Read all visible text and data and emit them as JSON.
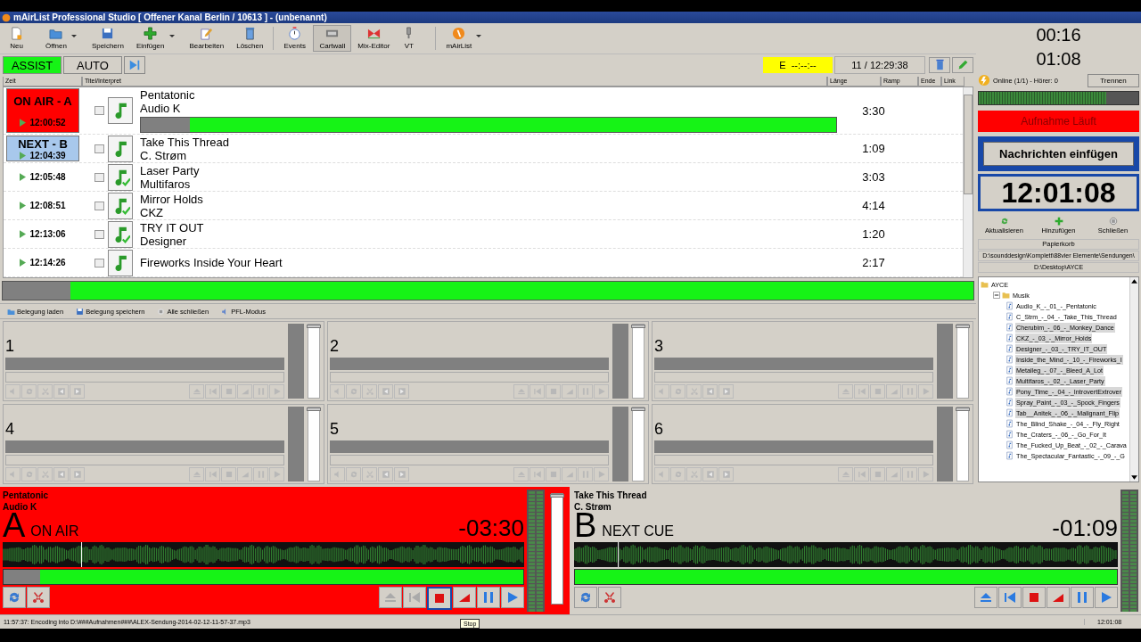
{
  "window": {
    "title": "mAirList Professional Studio [ Offener Kanal Berlin / 10613 ] - (unbenannt)"
  },
  "toolbar": [
    {
      "label": "Neu",
      "kind": "doc",
      "dropdown": false
    },
    {
      "label": "Öffnen",
      "kind": "folder",
      "dropdown": true
    },
    {
      "label": "Speichern",
      "kind": "disk",
      "dropdown": false
    },
    {
      "label": "Einfügen",
      "kind": "plus",
      "dropdown": true
    },
    {
      "label": "Bearbeiten",
      "kind": "pencil",
      "dropdown": false
    },
    {
      "label": "Löschen",
      "kind": "trash",
      "dropdown": false
    },
    {
      "label": "Events",
      "kind": "stopwatch",
      "dropdown": false
    },
    {
      "label": "Cartwall",
      "kind": "cartwall",
      "dropdown": false
    },
    {
      "label": "Mix-Editor",
      "kind": "mixer",
      "dropdown": false
    },
    {
      "label": "VT",
      "kind": "mic",
      "dropdown": false
    },
    {
      "label": "mAirList",
      "kind": "logo",
      "dropdown": true
    }
  ],
  "modes": [
    {
      "label": "ASSIST",
      "selected": true
    },
    {
      "label": "AUTO",
      "selected": false
    }
  ],
  "event_display": "E  --:--:--",
  "count_display": "11 / 12:29:38",
  "playlist": {
    "columns": [
      "Zeit",
      "Titel/Interpret",
      "Länge",
      "Ramp",
      "Ende",
      "Link"
    ],
    "rows": [
      {
        "kind": "onair",
        "badge": "ON AIR - A",
        "time": "12:00:52",
        "title": "Pentatonic",
        "artist": "Audio K",
        "length": "3:30",
        "played": false,
        "level": 0.07
      },
      {
        "kind": "next",
        "badge": "NEXT - B",
        "time": "12:04:39",
        "title": "Take This Thread",
        "artist": "C. Strøm",
        "length": "1:09",
        "played": false
      },
      {
        "kind": "track",
        "time": "12:05:48",
        "title": "Laser Party",
        "artist": "Multifaros",
        "length": "3:03",
        "played": true
      },
      {
        "kind": "track",
        "time": "12:08:51",
        "title": "Mirror Holds",
        "artist": "CKZ",
        "length": "4:14",
        "played": true
      },
      {
        "kind": "track",
        "time": "12:13:06",
        "title": "TRY IT OUT",
        "artist": "Designer",
        "length": "1:20",
        "played": true
      },
      {
        "kind": "track",
        "time": "12:14:26",
        "title": "Fireworks Inside Your Heart",
        "length": "2:17",
        "played": false
      }
    ]
  },
  "playlist_progress": {
    "level": 0.07
  },
  "cartwall": {
    "toolbar": [
      "Belegung laden",
      "Belegung speichern",
      "Alle schließen",
      "PFL-Modus"
    ],
    "carts": [
      {
        "label": "1",
        "fader": {
          "level": 1
        }
      },
      {
        "label": "2",
        "fader": {
          "level": 1
        }
      },
      {
        "label": "3",
        "fader": {
          "level": 1
        }
      },
      {
        "label": "4",
        "fader": {
          "level": 1
        }
      },
      {
        "label": "5",
        "fader": {
          "level": 1
        }
      },
      {
        "label": "6",
        "fader": {
          "level": 1
        }
      }
    ]
  },
  "clocks": [
    "00:16",
    "01:08"
  ],
  "stream": {
    "status": "Online (1/1) - Hörer: 0",
    "button": "Trennen",
    "level": 0.8
  },
  "recording": "Aufnahme Läuft",
  "news_button": "Nachrichten einfügen",
  "big_clock": "12:01:08",
  "browser": {
    "toolbar": [
      "Aktualisieren",
      "Hinzufügen",
      "Schließen"
    ],
    "tab": "Papierkorb",
    "paths": [
      "D:\\sounddesign\\Komplett\\88vier Elemente\\Sendungen\\",
      "D:\\Desktop\\AYCE"
    ],
    "tree": [
      {
        "label": "AYCE",
        "kind": "folder",
        "children": [
          {
            "label": "Musik",
            "kind": "folder",
            "expanded": true,
            "children": [
              {
                "label": "Audio_K_-_01_-_Pentatonic",
                "kind": "file",
                "selected": false
              },
              {
                "label": "C_Strm_-_04_-_Take_This_Thread",
                "kind": "file",
                "selected": false
              },
              {
                "label": "Cherubim_-_06_-_Monkey_Dance",
                "kind": "file",
                "selected": true
              },
              {
                "label": "CKZ_-_03_-_Mirror_Holds",
                "kind": "file",
                "selected": true
              },
              {
                "label": "Designer_-_03_-_TRY_IT_OUT",
                "kind": "file",
                "selected": true
              },
              {
                "label": "Inside_the_Mind_-_10_-_Fireworks_I",
                "kind": "file",
                "selected": true
              },
              {
                "label": "Metalleg_-_07_-_Bleed_A_Lot",
                "kind": "file",
                "selected": true
              },
              {
                "label": "Multifaros_-_02_-_Laser_Party",
                "kind": "file",
                "selected": true
              },
              {
                "label": "Pony_Time_-_04_-_IntrovertExtrover",
                "kind": "file",
                "selected": true
              },
              {
                "label": "Spray_Paint_-_03_-_Spock_Fingers",
                "kind": "file",
                "selected": true
              },
              {
                "label": "Tab__Anitek_-_06_-_Malignant_Flip",
                "kind": "file",
                "selected": true
              },
              {
                "label": "The_Blind_Shake_-_04_-_Fly_Right",
                "kind": "file",
                "selected": false
              },
              {
                "label": "The_Craters_-_06_-_Go_For_It",
                "kind": "file",
                "selected": false
              },
              {
                "label": "The_Fucked_Up_Beat_-_02_-_Carava",
                "kind": "file",
                "selected": false
              },
              {
                "label": "The_Spectacular_Fantastic_-_09_-_G",
                "kind": "file",
                "selected": false
              }
            ]
          }
        ]
      }
    ]
  },
  "players": [
    {
      "letter": "A",
      "title": "Pentatonic",
      "artist": "Audio K",
      "status": "ON AIR",
      "remaining": "-03:30",
      "on_air": true,
      "progress": {
        "level": 0.07
      },
      "fader": {
        "level": 1
      }
    },
    {
      "letter": "B",
      "title": "Take This Thread",
      "artist": "C. Strøm",
      "status": "NEXT CUE",
      "remaining": "-01:09",
      "on_air": false
    }
  ],
  "tooltip": "Stop",
  "status_bar": {
    "message": "11:57:37: Encoding into D:\\###Aufnahmen###\\ALEX-Sendung-2014-02-12-11-57-37.mp3",
    "time": "12:01:08"
  }
}
